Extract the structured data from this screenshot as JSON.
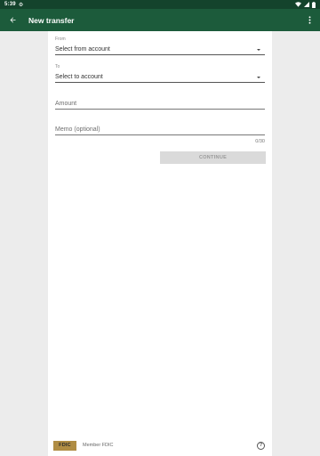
{
  "status_bar": {
    "time": "5:39",
    "icons": [
      "settings-gear-icon",
      "wifi-icon",
      "signal-icon",
      "battery-icon"
    ]
  },
  "app_bar": {
    "title": "New transfer",
    "back_icon": "arrow-back-icon",
    "menu_icon": "more-vert-icon"
  },
  "form": {
    "from": {
      "label": "From",
      "value": "Select from account"
    },
    "to": {
      "label": "To",
      "value": "Select to account"
    },
    "amount": {
      "placeholder": "Amount"
    },
    "memo": {
      "placeholder": "Memo (optional)",
      "counter": "0/30"
    },
    "continue_label": "CONTINUE"
  },
  "footer": {
    "logo_text": "FDIC",
    "member_text": "Member FDIC",
    "help_icon": "help-icon"
  },
  "colors": {
    "status_bar": "#14432c",
    "app_bar": "#1c5b3b",
    "background": "#ececec",
    "button_disabled": "#dadada",
    "fdic_gold": "#b08d44"
  }
}
